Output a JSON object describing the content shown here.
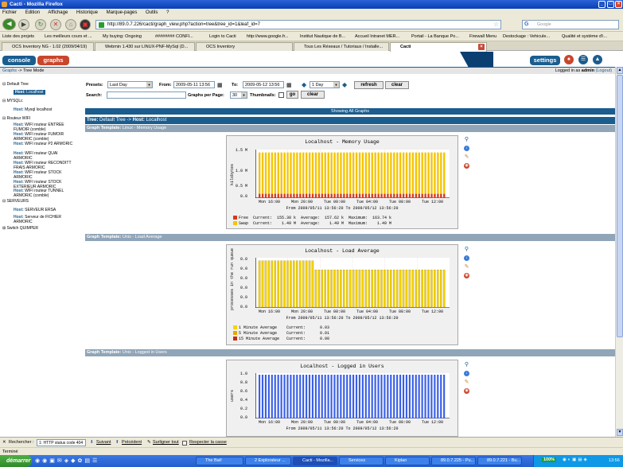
{
  "window": {
    "title": "Cacti - Mozilla Firefox"
  },
  "menu": [
    "Fichier",
    "Edition",
    "Affichage",
    "Historique",
    "Marque-pages",
    "Outils",
    "?"
  ],
  "nav": {
    "url": "http://89.0.7.226/cacti/graph_view.php?action=tree&tree_id=1&leaf_id=7",
    "search_placeholder": "Google"
  },
  "bookmarks": [
    "Liste des projets",
    "Les meilleurs cours et ...",
    "My buying: Ongoing",
    "######## CONFI...",
    "Login to Cacti",
    "http://www.google.fr...",
    "Institut Nautique de B...",
    "Accueil Intranet MER...",
    "Portail - La Banque Po...",
    "Firewall Menu",
    "Destockage : Vehicule...",
    "Qualité et système d'i..."
  ],
  "tabs": [
    "OCS Inventory NG - 1.02 (2009/04/19)",
    "Webmin 1.430 sur LINUX-PNF-MySql (D...",
    "OCS Inventory",
    "Tous Les Réseaux / Tutoriaux / Installe...",
    "Cacti"
  ],
  "cacti": {
    "console_label": "console",
    "graphs_label": "graphs",
    "settings_label": "settings",
    "breadcrumb": {
      "graphs": "Graphs",
      "sep": "->",
      "mode": "Tree Mode"
    },
    "login": {
      "prefix": "Logged in as",
      "user": "admin",
      "logout": "(Logout)"
    },
    "tree": {
      "default_tree": "Default Tree",
      "localhost": {
        "host_prefix": "Host:",
        "name": "Localhost"
      },
      "mysql_group": "MYSQLc",
      "mysql_host": {
        "host_prefix": "Host:",
        "name": "Mysql localhost"
      },
      "routeur_group": "Routeur WIFI",
      "routeur_hosts": [
        {
          "host_prefix": "Host:",
          "name": "WIFI routeur ENTREE FUMOIR (comble)"
        },
        {
          "host_prefix": "Host:",
          "name": "WIFI routeur FUMOIR ARMORIC (comble)"
        },
        {
          "host_prefix": "Host:",
          "name": "WIFI routeur P2 ARMORIC"
        },
        {
          "host_prefix": "Host:",
          "name": "WIFI routeur QUAI ARMORIC"
        },
        {
          "host_prefix": "Host:",
          "name": "WIFI routeur RECONDITT FRAIS ARMORIC"
        },
        {
          "host_prefix": "Host:",
          "name": "WIFI routeur STOCK ARMORIC"
        },
        {
          "host_prefix": "Host:",
          "name": "WIFI routeur STOCK EXTERIEUR ARMORIC"
        },
        {
          "host_prefix": "Host:",
          "name": "WIFI routeur TUNNEL ARMORIC (comble)"
        }
      ],
      "serveurs_group": "SERVEURS",
      "serveur_hosts": [
        {
          "host_prefix": "Host:",
          "name": "SERVEUR ERSA"
        },
        {
          "host_prefix": "Host:",
          "name": "Serveur de FICHIER ARMORIC"
        }
      ],
      "switch_group": "Switch QUIMPER"
    },
    "filters": {
      "presets_label": "Presets:",
      "presets_value": "Last Day",
      "from_label": "From:",
      "from_value": "2009-05-11 13:56",
      "to_label": "To:",
      "to_value": "2009-05-12 13:56",
      "span_value": "1 Day",
      "refresh_label": "refresh",
      "clear_label": "clear",
      "search_label": "Search:",
      "search_value": "",
      "per_page_label": "Graphs per Page:",
      "per_page_value": "30",
      "thumbnails_label": "Thumbnails:",
      "go_label": "go",
      "clear2_label": "clear"
    },
    "showing_all": "Showing All Graphs",
    "tree_header": {
      "tree_label": "Tree:",
      "tree_name": "Default Tree",
      "arrow": "->",
      "host_label": "Host:",
      "host_name": "Localhost"
    },
    "templates": [
      {
        "label": "Graph Template:",
        "name": "Linux - Memory Usage"
      },
      {
        "label": "Graph Template:",
        "name": "Unix - Load Average"
      },
      {
        "label": "Graph Template:",
        "name": "Unix - Logged in Users"
      }
    ]
  },
  "chart_data": [
    {
      "type": "bar",
      "title": "Localhost - Memory Usage",
      "ylabel": "kilobytes",
      "yticks": [
        "1.5 M",
        "1.0 M",
        "0.5 M",
        "0.0"
      ],
      "ylim": [
        0,
        1750000
      ],
      "xticks": [
        "Mon 16:00",
        "Mon 20:00",
        "Tue 00:00",
        "Tue 04:00",
        "Tue 08:00",
        "Tue 12:00"
      ],
      "from_line": "From 2009/05/11 13:56:20 To 2009/05/12 13:56:20",
      "series": [
        {
          "name": "Free",
          "color": "#d83a1a",
          "stat": "Current:  155.38 k  Average:  157.62 k  Maximum:  163.74 k",
          "value": 155380
        },
        {
          "name": "Swap",
          "color": "#f5c400",
          "stat": "Current:    1.49 M  Average:    1.49 M  Maximum:    1.49 M",
          "value": 1490000
        }
      ]
    },
    {
      "type": "bar",
      "title": "Localhost - Load Average",
      "ylabel": "processes in the run queue",
      "yticks": [
        "0.0",
        "0.0",
        "0.0",
        "0.0",
        "0.0",
        "0.0"
      ],
      "ylim": [
        0,
        1
      ],
      "xticks": [
        "Mon 16:00",
        "Mon 20:00",
        "Tue 00:00",
        "Tue 04:00",
        "Tue 08:00",
        "Tue 12:00"
      ],
      "from_line": "From 2009/05/11 13:56:20 To 2009/05/12 13:56:20",
      "series": [
        {
          "name": "1 Minute Average",
          "color": "#f5d400",
          "stat": "Current:      0.03"
        },
        {
          "name": "5 Minute Average",
          "color": "#e8a800",
          "stat": "Current:      0.01"
        },
        {
          "name": "15 Minute Average",
          "color": "#c43010",
          "stat": "Current:      0.00"
        }
      ]
    },
    {
      "type": "bar",
      "title": "Localhost - Logged in Users",
      "ylabel": "users",
      "yticks": [
        "1.0",
        "0.8",
        "0.6",
        "0.4",
        "0.2",
        "0.0"
      ],
      "ylim": [
        0,
        1
      ],
      "xticks": [
        "Mon 16:00",
        "Mon 20:00",
        "Tue 00:00",
        "Tue 04:00",
        "Tue 08:00",
        "Tue 12:00"
      ],
      "from_line": "From 2009/05/11 13:56:20 To 2009/05/12 13:56:20",
      "series": [
        {
          "name": "Users",
          "color": "#3a5fe6",
          "value": 1
        }
      ]
    }
  ],
  "findbar": {
    "search_label": "Rechercher :",
    "search_value": "1: HTTP status code 404",
    "next": "Suivant",
    "prev": "Précédent",
    "highlight": "Surligner tout",
    "match_case": "Respecter la casse"
  },
  "status": "Terminé",
  "taskbar": {
    "start": "démarrer",
    "tasks": [
      "The Bat!",
      "2 Explorateur ...",
      "Cacti - Mozilla...",
      "Services",
      "Kiplan",
      "89.0.7.225 - Pu...",
      "89.0.7.221 - Bu..."
    ],
    "zoom": "100%",
    "clock": "13:56"
  }
}
